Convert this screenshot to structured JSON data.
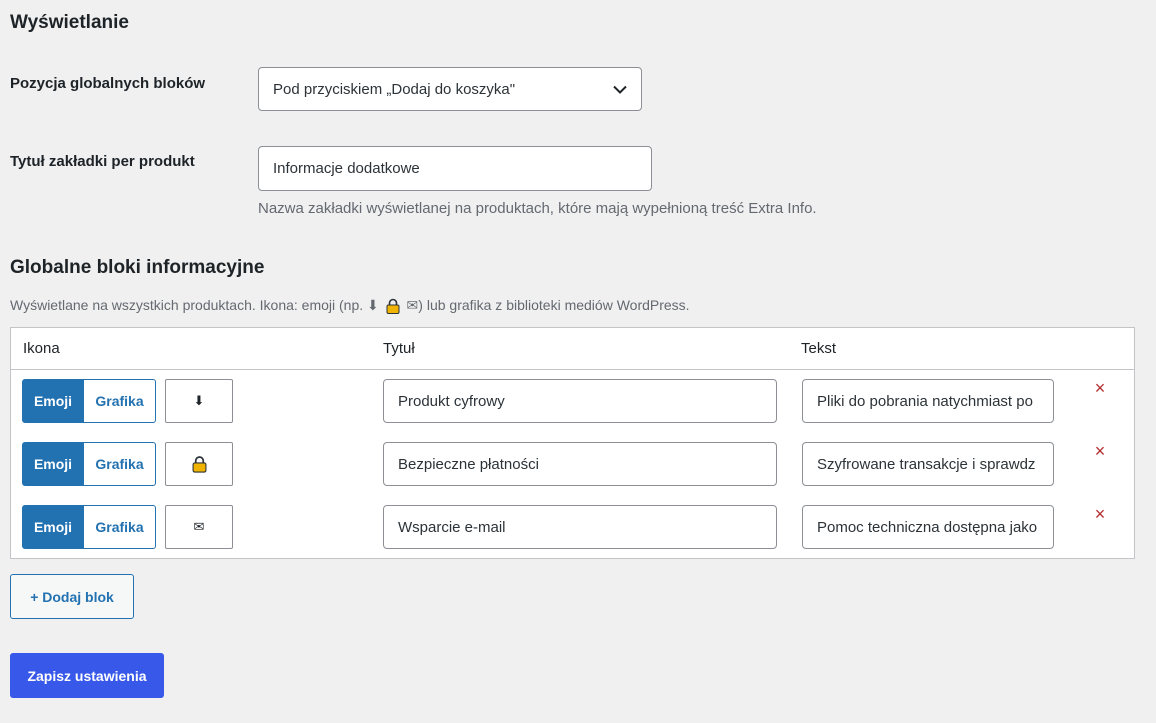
{
  "display_section": {
    "heading": "Wyświetlanie"
  },
  "position_field": {
    "label": "Pozycja globalnych bloków",
    "selected": "Pod przyciskiem „Dodaj do koszyka\""
  },
  "tab_title_field": {
    "label": "Tytuł zakładki per produkt",
    "value": "Informacje dodatkowe",
    "description": "Nazwa zakładki wyświetlanej na produktach, które mają wypełnioną treść Extra Info."
  },
  "global_blocks": {
    "heading": "Globalne bloki informacyjne",
    "description_prefix": "Wyświetlane na wszystkich produktach. Ikona: emoji (np. ⬇",
    "description_suffix": "✉) lub grafika z biblioteki mediów WordPress.",
    "columns": {
      "icon": "Ikona",
      "title": "Tytuł",
      "text": "Tekst"
    },
    "rows": [
      {
        "mode_emoji": "Emoji",
        "mode_image": "Grafika",
        "emoji": "⬇",
        "title": "Produkt cyfrowy",
        "text": "Pliki do pobrania natychmiast po",
        "remove": "×"
      },
      {
        "mode_emoji": "Emoji",
        "mode_image": "Grafika",
        "emoji": "lock-icon",
        "title": "Bezpieczne płatności",
        "text": "Szyfrowane transakcje i sprawdz",
        "remove": "×"
      },
      {
        "mode_emoji": "Emoji",
        "mode_image": "Grafika",
        "emoji": "✉",
        "title": "Wsparcie e-mail",
        "text": "Pomoc techniczna dostępna jako",
        "remove": "×"
      }
    ]
  },
  "actions": {
    "add_block": "+ Dodaj blok",
    "save": "Zapisz ustawienia"
  },
  "colors": {
    "primary": "#2271b1",
    "save": "#3858e9",
    "remove": "#b32d2e",
    "lock": "#f0b400"
  }
}
